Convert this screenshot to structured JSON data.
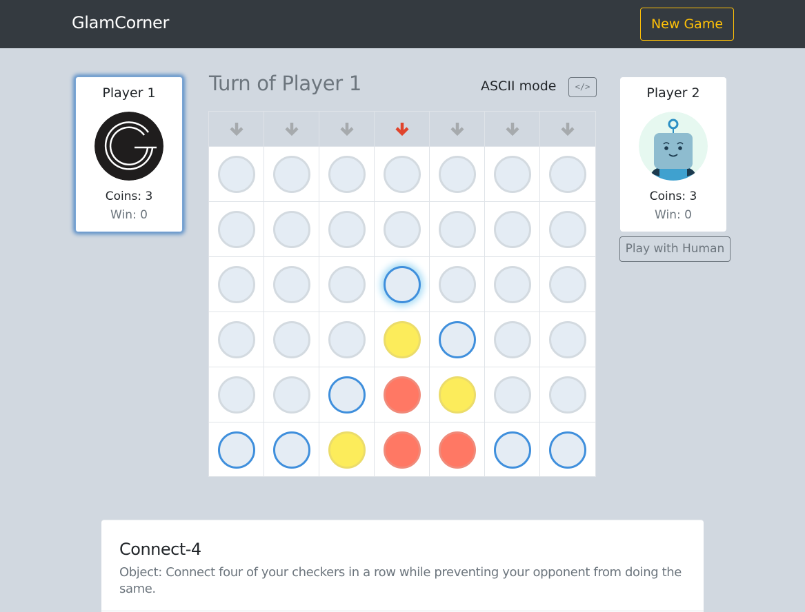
{
  "navbar": {
    "brand": "GlamCorner",
    "new_game_label": "New Game"
  },
  "players": [
    {
      "name": "Player 1",
      "coins_label": "Coins: 3",
      "coins": 3,
      "wins_label": "Win: 0",
      "wins": 0,
      "avatar": "glamcorner-logo-icon",
      "active": true
    },
    {
      "name": "Player 2",
      "coins_label": "Coins: 3",
      "coins": 3,
      "wins_label": "Win: 0",
      "wins": 0,
      "avatar": "robot-avatar-icon",
      "active": false
    }
  ],
  "play_mode_button": "Play with Human",
  "game": {
    "turn_label": "Turn of Player 1",
    "ascii_label": "ASCII mode",
    "ascii_button_glyph": "</>",
    "selected_column": 3,
    "colors": {
      "arrow": "#a6aaad",
      "arrow_selected": "#e0442c",
      "player1_disc": "#ff7864",
      "player2_disc": "#fcec5b",
      "available_ring": "#3f8fdc",
      "empty": "#e4ecf4"
    },
    "board": [
      [
        "empty",
        "empty",
        "empty",
        "empty",
        "empty",
        "empty",
        "empty"
      ],
      [
        "empty",
        "empty",
        "empty",
        "empty",
        "empty",
        "empty",
        "empty"
      ],
      [
        "empty",
        "empty",
        "empty",
        "glow",
        "empty",
        "empty",
        "empty"
      ],
      [
        "empty",
        "empty",
        "empty",
        "yellow",
        "avail",
        "empty",
        "empty"
      ],
      [
        "empty",
        "empty",
        "avail",
        "red",
        "yellow",
        "empty",
        "empty"
      ],
      [
        "avail",
        "avail",
        "yellow",
        "red",
        "red",
        "avail",
        "avail"
      ]
    ]
  },
  "info": {
    "title": "Connect-4",
    "description": "Object: Connect four of your checkers in a row while preventing your opponent from doing the same."
  }
}
